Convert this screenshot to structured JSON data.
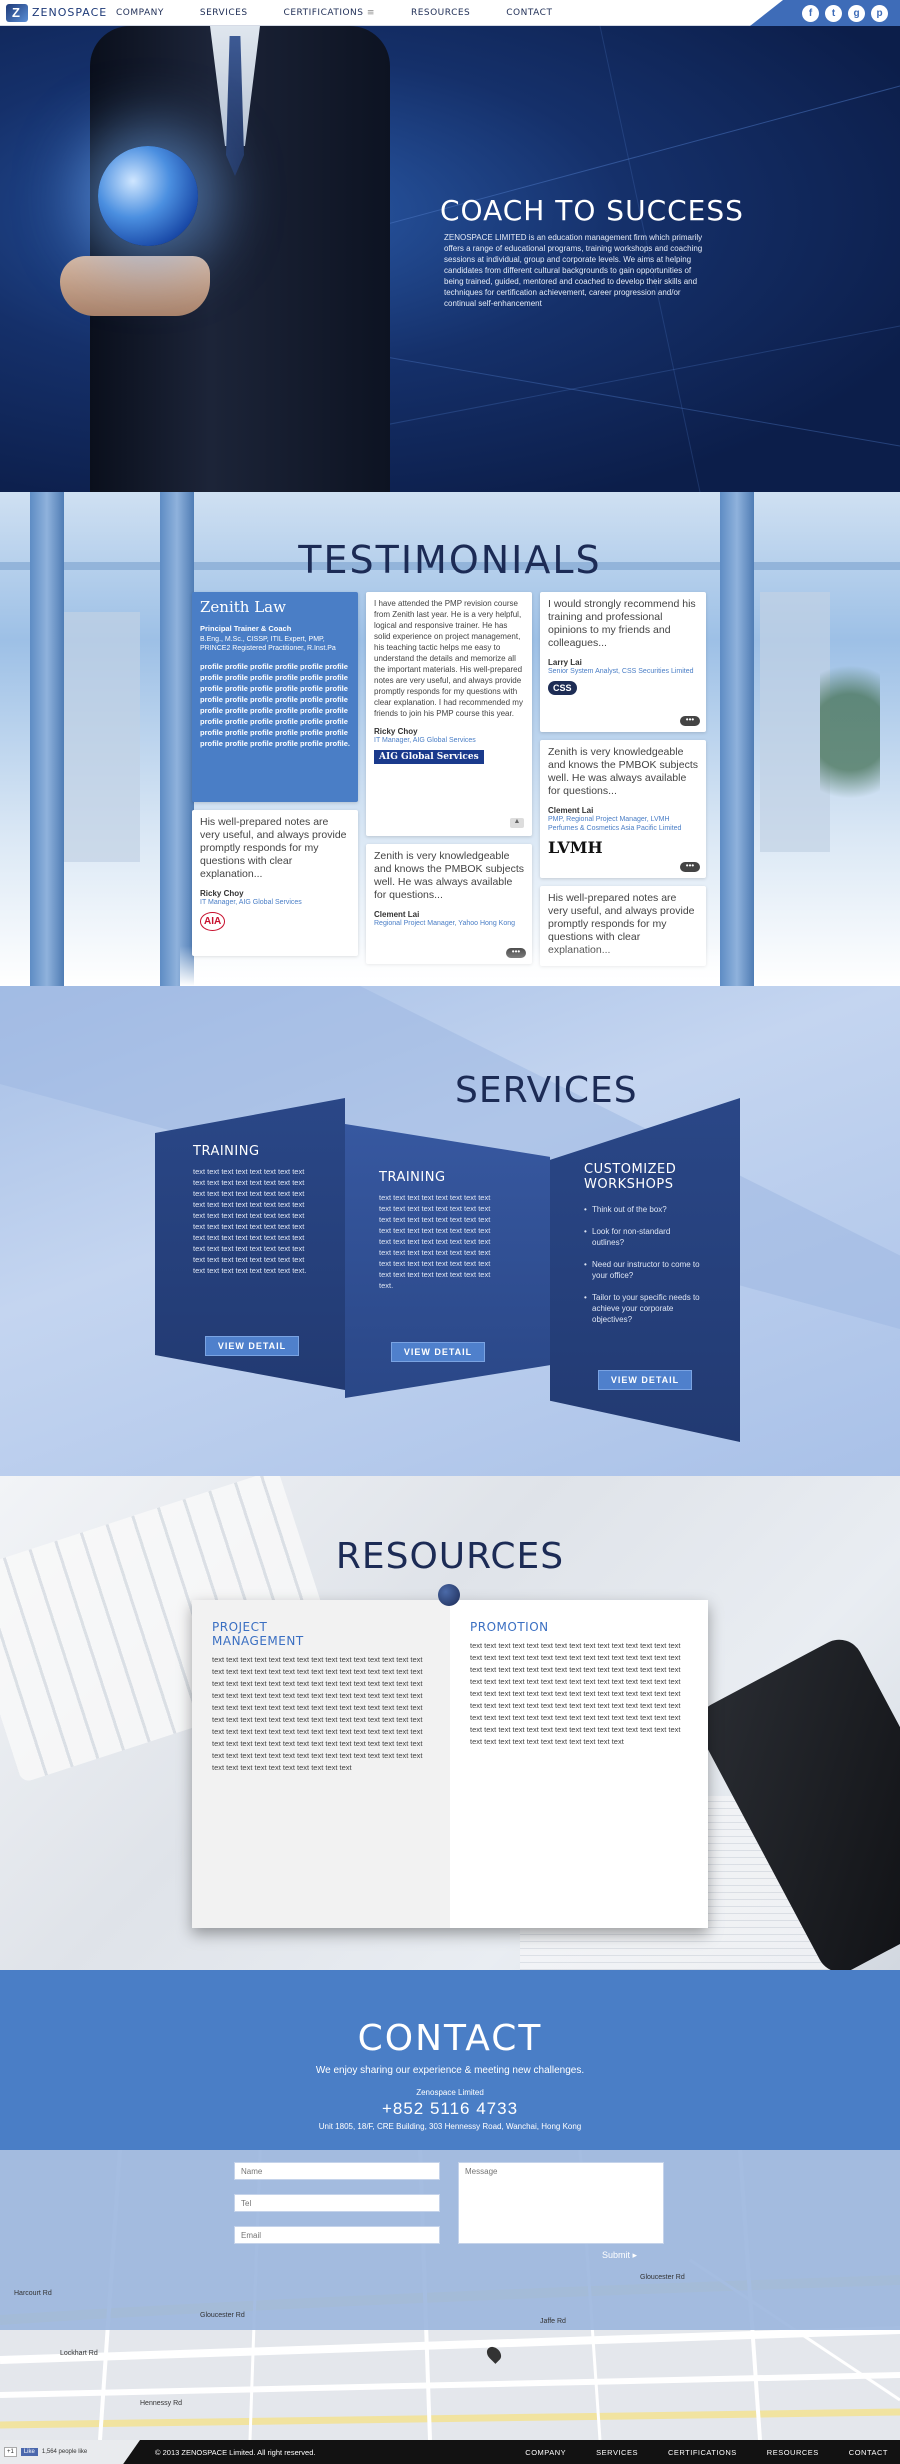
{
  "nav": {
    "logo": "ZENOSPACE",
    "items": [
      "COMPANY",
      "SERVICES",
      "CERTIFICATIONS",
      "RESOURCES",
      "CONTACT"
    ],
    "certifications_caret": "≡",
    "social": [
      "f",
      "t",
      "g",
      "p"
    ]
  },
  "hero": {
    "title": "COACH TO SUCCESS",
    "text": "ZENOSPACE LIMITED is an education management firm which primarily offers a range of educational programs, training workshops and coaching sessions at individual, group and corporate levels. We aims at helping candidates from different cultural backgrounds to gain opportunities of being trained, guided, mentored and coached to develop their skills and techniques for certification achievement, career progression and/or continual self-enhancement"
  },
  "testimonials": {
    "title": "TESTIMONIALS",
    "trainer": {
      "name": "Zenith Law",
      "role": "Principal Trainer & Coach",
      "quals": "B.Eng., M.Sc., CISSP, ITIL Expert, PMP, PRINCE2 Registered Practitioner, R.Inst.Pa",
      "profile": "profile profile profile profile profile profile profile profile profile profile profile profile profile profile profile profile profile profile profile profile profile profile profile profile profile profile profile profile profile profile profile profile profile profile profile profile profile profile profile profile profile profile profile profile profile profile profile profile."
    },
    "c1": {
      "quote": "His well-prepared notes are very useful, and always provide promptly responds for my questions with clear explanation...",
      "author": "Ricky Choy",
      "pos": "IT Manager, AIG Global Services",
      "logo": "AIA"
    },
    "c2": {
      "quote": "I have attended the PMP revision course from Zenith last year. He is a very helpful, logical and responsive trainer. He has solid experience on project management, his teaching tactic helps me easy to understand the details and memorize all the important materials. His well-prepared notes are very useful, and always provide promptly responds for my questions with clear explanation. I had recommended my friends to join his PMP course this year.",
      "author": "Ricky Choy",
      "pos": "IT Manager, AIG Global Services",
      "logo": "AIG Global Services"
    },
    "c3": {
      "quote": "Zenith is very knowledgeable and knows the PMBOK subjects well. He was always available for questions...",
      "author": "Clement Lai",
      "pos": "Regional Project Manager, Yahoo Hong Kong"
    },
    "c4": {
      "quote": "I would strongly recommend his training and professional opinions to my friends and colleagues...",
      "author": "Larry Lai",
      "pos": "Senior System Analyst, CSS Securities Limited",
      "logo": "CSS"
    },
    "c5": {
      "quote": "Zenith is very knowledgeable and knows the PMBOK subjects well. He was always available for questions...",
      "author": "Clement Lai",
      "pos": "PMP, Regional Project Manager, LVMH Perfumes & Cosmetics Asia Pacific Limited",
      "logo": "LVMH"
    },
    "c6": {
      "quote": "His well-prepared notes are very useful, and always provide promptly responds for my questions with clear explanation..."
    },
    "more": "•••",
    "up": "▲"
  },
  "services": {
    "title": "SERVICES",
    "p1": {
      "title": "TRAINING",
      "text": "text text text text text text text text text text text text text text text text text text text text text text text text text text text text text text text text text text text text text text text text text text text text text text text text text text text text text text text text text text text text text text text text text text text text text text text text text text text text text text text text.",
      "button": "VIEW DETAIL"
    },
    "p2": {
      "title": "TRAINING",
      "text": "text text text text text text text text text text text text text text text text text text text text text text text text text text text text text text text text text text text text text text text text text text text text text text text text text text text text text text text text text text text text text text text text text.",
      "button": "VIEW DETAIL"
    },
    "p3": {
      "title": "CUSTOMIZED WORKSHOPS",
      "bullets": [
        "Think out of the box?",
        "Look for non-standard outlines?",
        "Need our instructor to come to your office?",
        "Tailor to your specific needs to achieve your corporate objectives?"
      ],
      "button": "VIEW DETAIL"
    }
  },
  "resources": {
    "title": "RESOURCES",
    "left": {
      "title": "PROJECT MANAGEMENT",
      "text": "text text text text text text text text text text text text text text text text text text text text text text text text text text text text text text text text text text text text text text text text text text text text text text text text text text text text text text text text text text text text text text text text text text text text text text text text text text text text text text text text text text text text text text text text text text text text text text text text text text text text text text text text text text text text text text text text text text text text text text text text text text text text text text text text text text text text text text text text text text text text text text text text text"
    },
    "right": {
      "title": "PROMOTION",
      "text": "text text text text text text text text text text text text text text text text text text text text text text text text text text text text text text text text text text text text text text text text text text text text text text text text text text text text text text text text text text text text text text text text text text text text text text text text text text text text text text text text text text text text text text text text text text text text text text text text text text text text text text text text text text text text text text text text text text text text text text text text text text text text text text text text text text text"
    }
  },
  "contact": {
    "title": "CONTACT",
    "subtitle": "We enjoy sharing our experience & meeting new challenges.",
    "company": "Zenospace Limited",
    "phone": "+852 5116 4733",
    "address": "Unit 1805, 18/F, CRE Building, 303 Hennessy Road, Wanchai, Hong Kong"
  },
  "form": {
    "name_placeholder": "Name",
    "tel_placeholder": "Tel",
    "email_placeholder": "Email",
    "message_placeholder": "Message",
    "submit": "Submit ▸"
  },
  "map": {
    "labels": [
      "Harcourt Rd",
      "Gloucester Rd",
      "Gloucester Rd",
      "Hennessy Rd",
      "Lockhart Rd",
      "Jaffe Rd"
    ]
  },
  "footer": {
    "gplus": "+1",
    "like": "Like",
    "like_count": "1,564 people like",
    "copyright": "© 2013 ZENOSPACE Limited. All right reserved.",
    "links": [
      "COMPANY",
      "SERVICES",
      "CERTIFICATIONS",
      "RESOURCES",
      "CONTACT"
    ]
  }
}
